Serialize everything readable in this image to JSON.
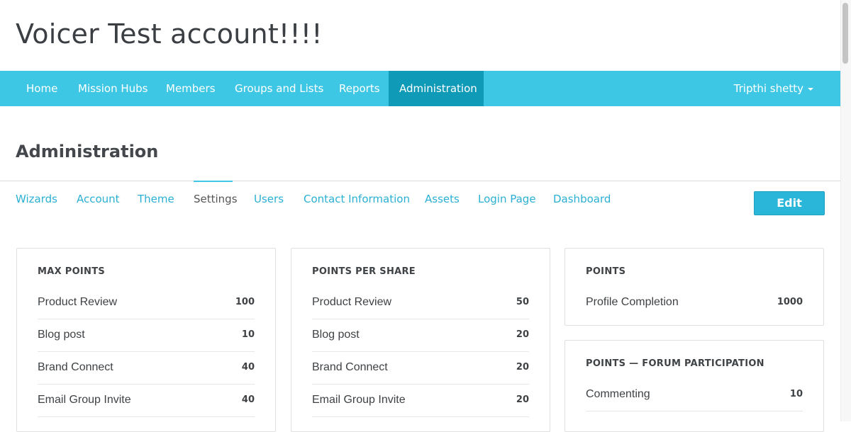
{
  "app": {
    "title": "Voicer Test account!!!!"
  },
  "nav": {
    "items": [
      "Home",
      "Mission Hubs",
      "Members",
      "Groups and Lists",
      "Reports",
      "Administration"
    ],
    "active": "Administration",
    "user": "Tripthi shetty"
  },
  "page": {
    "heading": "Administration"
  },
  "tabs": {
    "items": [
      "Wizards",
      "Account",
      "Theme",
      "Settings",
      "Users",
      "Contact Information",
      "Assets",
      "Login Page",
      "Dashboard"
    ],
    "active": "Settings",
    "edit_label": "Edit"
  },
  "cards": {
    "max_points": {
      "title": "MAX POINTS",
      "rows": [
        {
          "label": "Product Review",
          "value": "100"
        },
        {
          "label": "Blog post",
          "value": "10"
        },
        {
          "label": "Brand Connect",
          "value": "40"
        },
        {
          "label": "Email Group Invite",
          "value": "40"
        }
      ]
    },
    "points_per_share": {
      "title": "POINTS PER SHARE",
      "rows": [
        {
          "label": "Product Review",
          "value": "50"
        },
        {
          "label": "Blog post",
          "value": "20"
        },
        {
          "label": "Brand Connect",
          "value": "20"
        },
        {
          "label": "Email Group Invite",
          "value": "20"
        }
      ]
    },
    "points": {
      "title": "POINTS",
      "rows": [
        {
          "label": "Profile Completion",
          "value": "1000"
        }
      ]
    },
    "forum": {
      "title": "POINTS — FORUM PARTICIPATION",
      "rows": [
        {
          "label": "Commenting",
          "value": "10"
        }
      ]
    }
  },
  "colors": {
    "nav_bg": "#3ec7e5",
    "nav_active": "#0f9ab8",
    "link": "#2bb0d3",
    "button": "#2ab6d8"
  }
}
